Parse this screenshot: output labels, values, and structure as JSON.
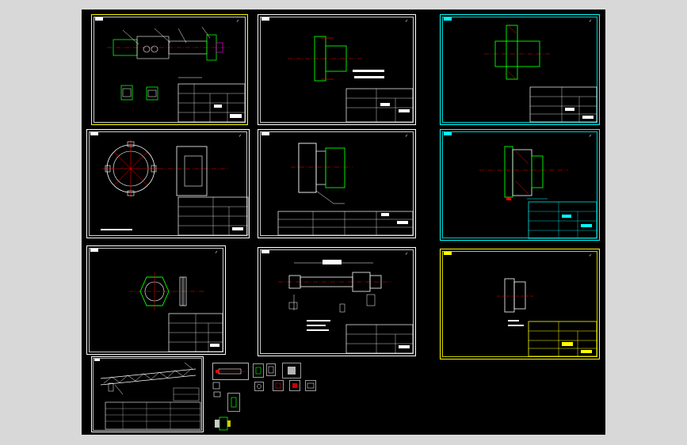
{
  "app": {
    "view": "model-space",
    "background_color": "#000000",
    "surround_color": "#d8d8d8"
  },
  "colors": {
    "white": "#ffffff",
    "yellow": "#ffff00",
    "cyan": "#00ffff",
    "green": "#00ff00",
    "red": "#ff0000",
    "blue": "#3a6cff",
    "magenta": "#ff00ff"
  },
  "sheets": [
    {
      "id": "s1",
      "border": "#ffff00",
      "variant": "shaft-assembly"
    },
    {
      "id": "s2",
      "border": "#ffffff",
      "variant": "flange-side"
    },
    {
      "id": "s3",
      "border": "#00ffff",
      "variant": "hub-section"
    },
    {
      "id": "s4",
      "border": "#ffffff",
      "variant": "gear-plate"
    },
    {
      "id": "s5",
      "border": "#ffffff",
      "variant": "bracket-section"
    },
    {
      "id": "s6",
      "border": "#00ffff",
      "variant": "bearing-housing"
    },
    {
      "id": "s7",
      "border": "#ffffff",
      "variant": "hex-nut"
    },
    {
      "id": "s8",
      "border": "#ffffff",
      "variant": "long-shaft"
    },
    {
      "id": "s9",
      "border": "#ffff00",
      "variant": "sleeve"
    },
    {
      "id": "s10",
      "border": "#ffffff",
      "variant": "assembly-drawing"
    }
  ],
  "thumbnails": [
    {
      "id": "t1",
      "type": "part-strip"
    },
    {
      "id": "t2",
      "type": "square-part"
    },
    {
      "id": "t3",
      "type": "square-part"
    },
    {
      "id": "t4",
      "type": "square-part"
    },
    {
      "id": "t5",
      "type": "small-part"
    },
    {
      "id": "t6",
      "type": "small-part"
    },
    {
      "id": "t7",
      "type": "small-part"
    },
    {
      "id": "t8",
      "type": "small-part"
    },
    {
      "id": "t9",
      "type": "small-part"
    },
    {
      "id": "t10",
      "type": "small-part"
    },
    {
      "id": "t11",
      "type": "small-part"
    },
    {
      "id": "t12",
      "type": "small-part"
    }
  ]
}
